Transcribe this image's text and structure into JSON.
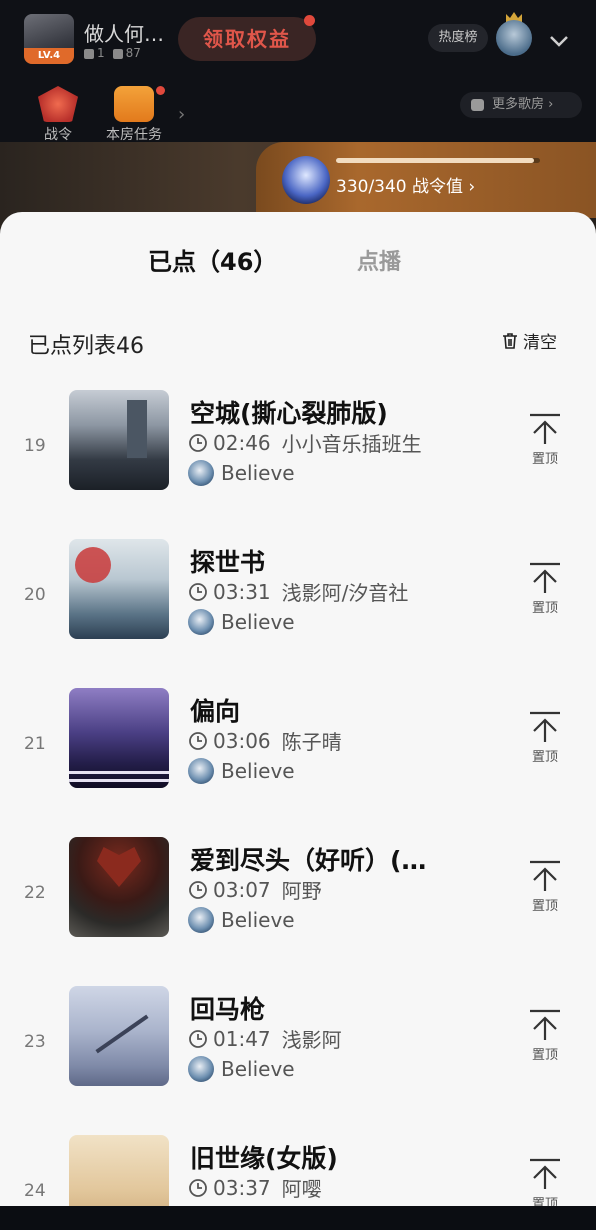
{
  "header": {
    "room_name": "做人何…",
    "room_level": "LV.4",
    "fans_count": "1",
    "members_count": "87",
    "claim_label": "领取权益",
    "hot_rank_label": "热度榜",
    "nav": {
      "war_order": "战令",
      "room_task": "本房任务",
      "more_rooms": "更多歌房"
    }
  },
  "battle_pass": {
    "current": 330,
    "target": 340,
    "text": "330/340 战令值",
    "progress_fraction": 0.97
  },
  "tabs": {
    "ordered": "已点（46）",
    "request": "点播"
  },
  "list": {
    "title": "已点列表46",
    "clear_label": "清空",
    "pin_label": "置顶",
    "songs": [
      {
        "index": "19",
        "title": "空城(撕心裂肺版)",
        "duration": "02:46",
        "artist": "小小音乐插班生",
        "requester": "Believe"
      },
      {
        "index": "20",
        "title": "探世书",
        "duration": "03:31",
        "artist": "浅影阿/汐音社",
        "requester": "Believe"
      },
      {
        "index": "21",
        "title": "偏向",
        "duration": "03:06",
        "artist": "陈子晴",
        "requester": "Believe"
      },
      {
        "index": "22",
        "title": "爱到尽头（好听）(…",
        "duration": "03:07",
        "artist": "阿野",
        "requester": "Believe"
      },
      {
        "index": "23",
        "title": "回马枪",
        "duration": "01:47",
        "artist": "浅影阿",
        "requester": "Believe"
      },
      {
        "index": "24",
        "title": "旧世缘(女版)",
        "duration": "03:37",
        "artist": "阿嘤",
        "requester": ""
      }
    ]
  }
}
